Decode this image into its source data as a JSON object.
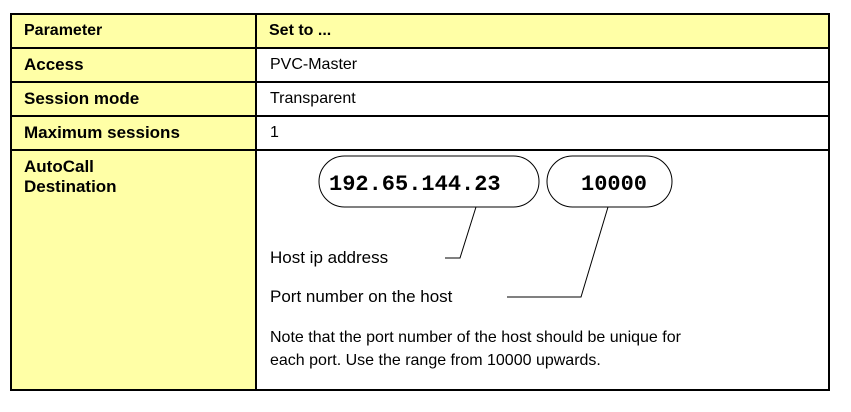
{
  "table": {
    "header": {
      "param": "Parameter",
      "value": "Set to ..."
    },
    "rows": [
      {
        "param": "Access",
        "value": "PVC-Master"
      },
      {
        "param": "Session mode",
        "value": "Transparent"
      },
      {
        "param": "Maximum sessions",
        "value": "1"
      }
    ],
    "autocall": {
      "param_line1": "AutoCall",
      "param_line2": "Destination",
      "ip_address": "192.65.144.23",
      "port": "10000",
      "ip_label": "Host ip address",
      "port_label": "Port number on the host",
      "note_line1": "Note that the port number of the host should be unique for",
      "note_line2": "each port. Use the range from 10000 upwards."
    }
  },
  "colors": {
    "header_bg": "#ffffa6",
    "param_bg": "#ffffa6",
    "border": "#000000"
  }
}
